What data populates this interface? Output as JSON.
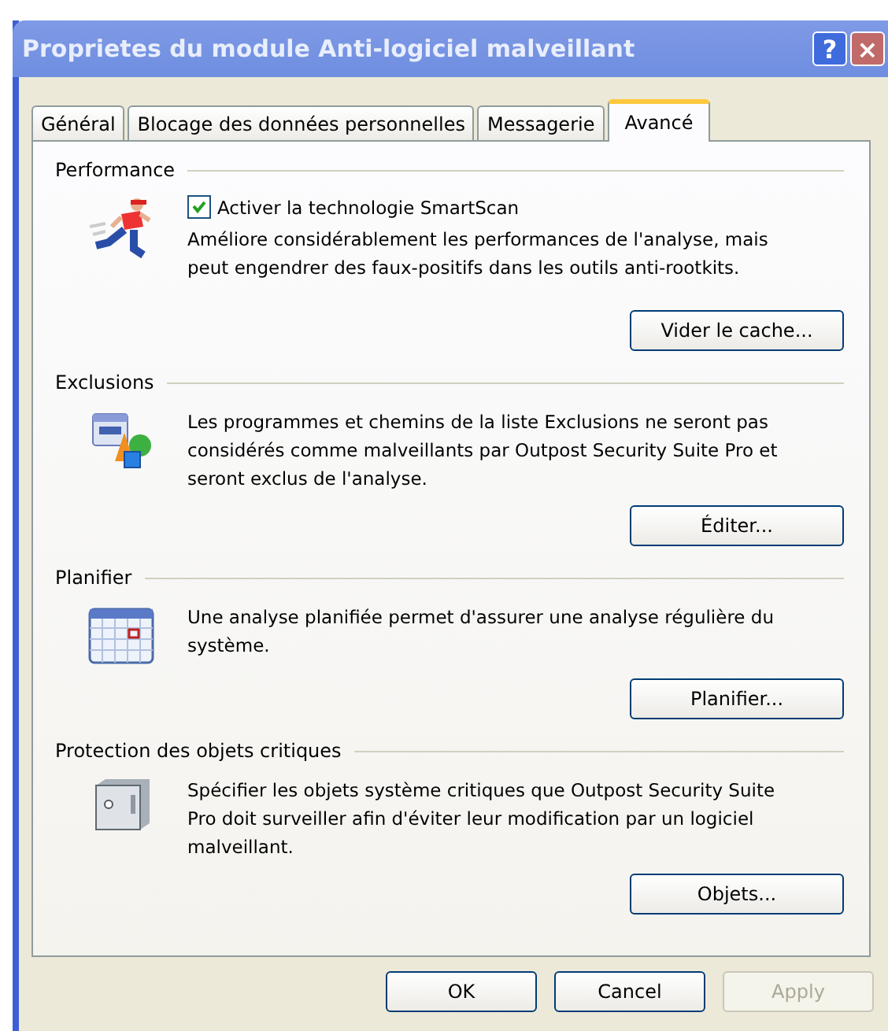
{
  "window": {
    "title": "Proprietes du module Anti-logiciel malveillant",
    "help": "?",
    "close": "×"
  },
  "tabs": [
    {
      "label": "Général",
      "selected": false
    },
    {
      "label": "Blocage des données personnelles",
      "selected": false
    },
    {
      "label": "Messagerie",
      "selected": false
    },
    {
      "label": "Avancé",
      "selected": true
    }
  ],
  "sections": [
    {
      "title": "Performance",
      "checkbox": {
        "label": "Activer la technologie SmartScan",
        "checked": true
      },
      "description": "Améliore considérablement les performances de l'analyse, mais\npeut engendrer des faux-positifs dans les outils anti-rootkits.",
      "button": "Vider le cache..."
    },
    {
      "title": "Exclusions",
      "description": "Les programmes et chemins de la liste Exclusions ne seront pas\nconsidérés comme malveillants par Outpost Security Suite Pro et\nseront exclus de l'analyse.",
      "button": "Éditer..."
    },
    {
      "title": "Planifier",
      "description": "Une analyse planifiée permet d'assurer une analyse régulière du\nsystème.",
      "button": "Planifier..."
    },
    {
      "title": "Protection des objets critiques",
      "description": "Spécifier les objets système critiques que Outpost Security Suite\nPro doit surveiller afin d'éviter leur modification par un logiciel\nmalveillant.",
      "button": "Objets..."
    }
  ],
  "buttons": [
    {
      "label": "OK",
      "disabled": false
    },
    {
      "label": "Cancel",
      "disabled": false
    },
    {
      "label": "Apply",
      "disabled": true
    }
  ]
}
